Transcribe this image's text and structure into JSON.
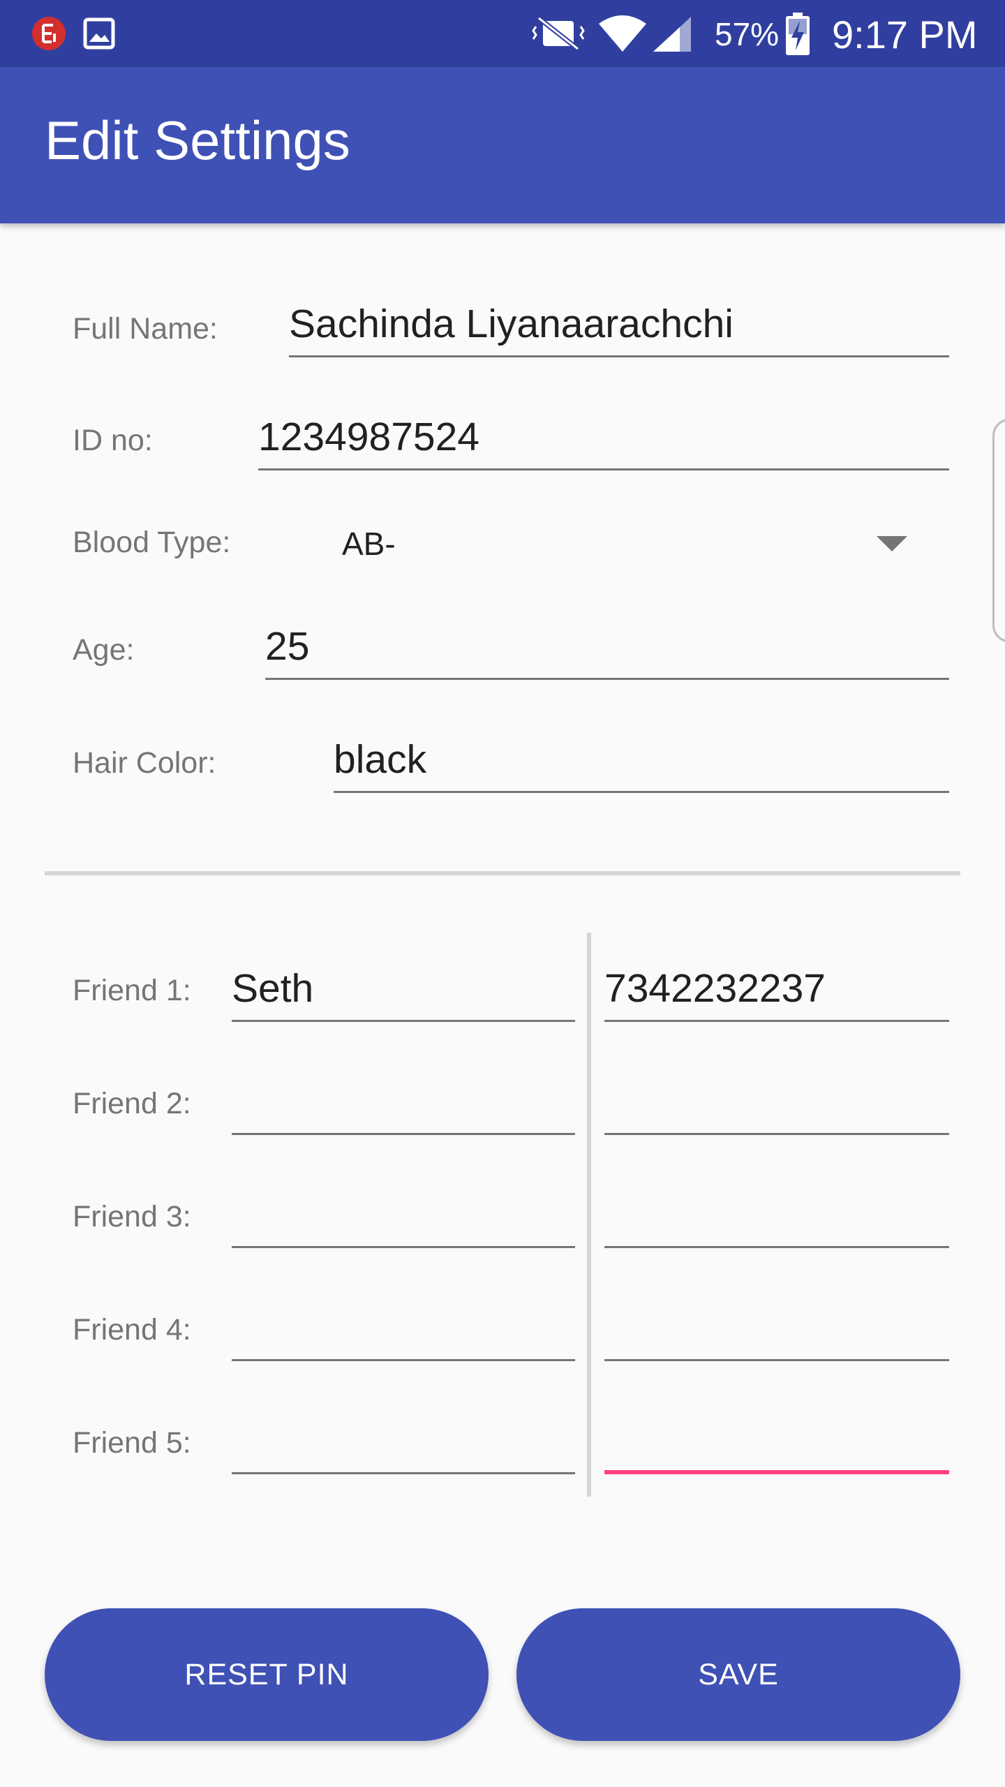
{
  "status_bar": {
    "battery_percent": "57%",
    "time": "9:17 PM",
    "icons": [
      "notification-app-icon",
      "image-icon",
      "vibrate-icon",
      "wifi-icon",
      "signal-icon",
      "battery-charging-icon"
    ]
  },
  "app_bar": {
    "title": "Edit Settings"
  },
  "form": {
    "full_name": {
      "label": "Full Name:",
      "value": "Sachinda Liyanaarachchi"
    },
    "id_no": {
      "label": "ID no:",
      "value": "1234987524"
    },
    "blood_type": {
      "label": "Blood Type:",
      "value": "AB-"
    },
    "age": {
      "label": "Age:",
      "value": "25"
    },
    "hair_color": {
      "label": "Hair Color:",
      "value": "black"
    }
  },
  "friends": [
    {
      "label": "Friend 1:",
      "name": "Seth",
      "phone": "7342232237"
    },
    {
      "label": "Friend 2:",
      "name": "",
      "phone": ""
    },
    {
      "label": "Friend 3:",
      "name": "",
      "phone": ""
    },
    {
      "label": "Friend 4:",
      "name": "",
      "phone": ""
    },
    {
      "label": "Friend 5:",
      "name": "",
      "phone": ""
    }
  ],
  "buttons": {
    "reset_pin": "RESET PIN",
    "save": "SAVE"
  },
  "colors": {
    "primary": "#3f51b5",
    "primary_dark": "#303f9f",
    "accent": "#ff4081"
  }
}
